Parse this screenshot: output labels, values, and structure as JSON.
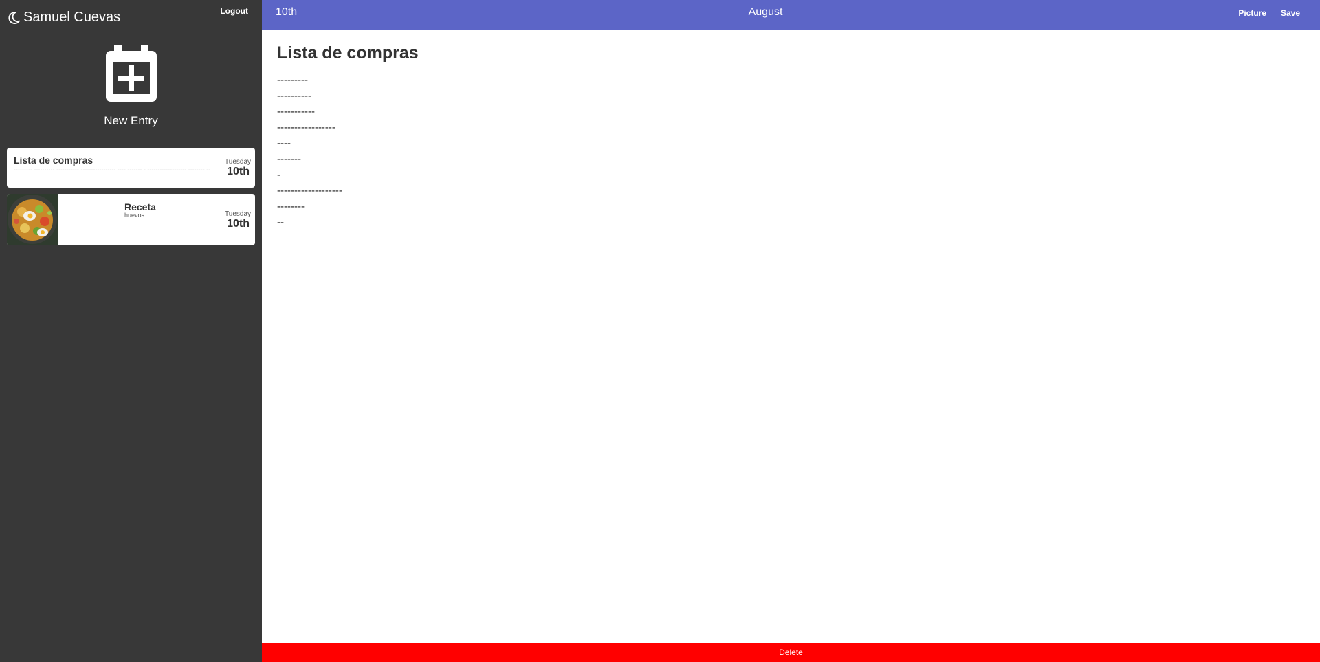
{
  "sidebar": {
    "user_name": "Samuel Cuevas",
    "logout_label": "Logout",
    "new_entry_label": "New Entry",
    "entries": [
      {
        "title": "Lista de compras",
        "snippet": "--------- ---------- ----------- ----------------- ---- ------- - ------------------- -------- --",
        "day_name": "Tuesday",
        "date": "10th"
      },
      {
        "title": "Receta",
        "snippet": "huevos",
        "day_name": "Tuesday",
        "date": "10th"
      }
    ]
  },
  "topbar": {
    "day": "10th",
    "month": "August",
    "picture_label": "Picture",
    "save_label": "Save"
  },
  "editor": {
    "title": "Lista de compras",
    "lines": [
      "---------",
      "----------",
      "-----------",
      "-----------------",
      "----",
      "-------",
      "-",
      "-------------------",
      "--------",
      "--"
    ]
  },
  "footer": {
    "delete_label": "Delete"
  },
  "colors": {
    "sidebar_bg": "#383838",
    "topbar_bg": "#5c65c7",
    "delete_bg": "#ff0000"
  },
  "icons": {
    "user": "moon-icon",
    "new_entry": "calendar-plus-icon"
  }
}
